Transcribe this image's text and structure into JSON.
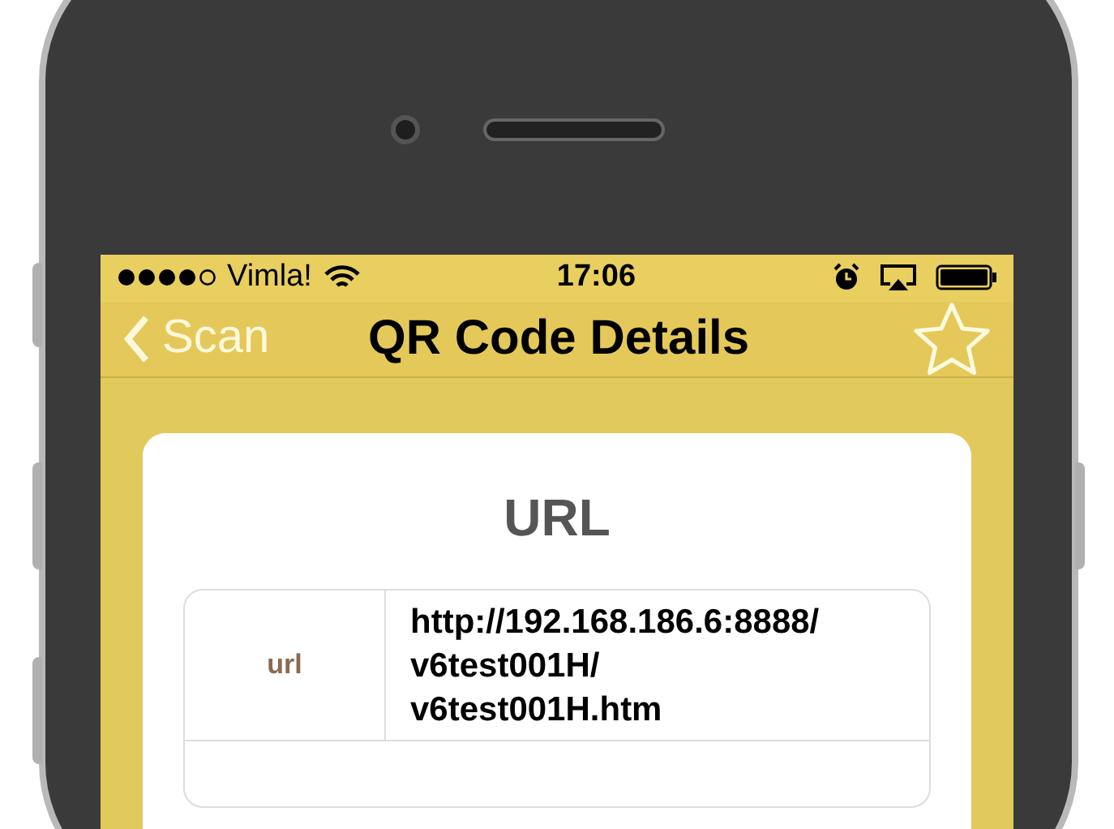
{
  "status_bar": {
    "carrier": "Vimla!",
    "time": "17:06"
  },
  "nav_bar": {
    "back": "Scan",
    "title": "QR Code Details",
    "starred": false
  },
  "card": {
    "title": "URL",
    "rows": [
      {
        "label": "url",
        "value_lines": [
          "http://192.168.186.6:8888/",
          "v6test001H/",
          "v6test001H.htm"
        ]
      }
    ]
  }
}
